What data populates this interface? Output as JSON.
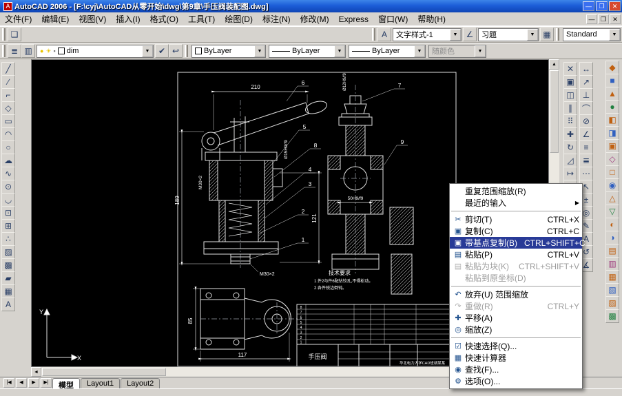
{
  "window": {
    "title": "AutoCAD 2006 - [F:\\cyj\\AutoCAD从零开始\\dwg\\第9章\\手压阀装配图.dwg]",
    "appicon_letter": "A",
    "controls": {
      "min": "—",
      "max": "❐",
      "close": "✕"
    }
  },
  "menus": [
    "文件(F)",
    "编辑(E)",
    "视图(V)",
    "插入(I)",
    "格式(O)",
    "工具(T)",
    "绘图(D)",
    "标注(N)",
    "修改(M)",
    "Express",
    "窗口(W)",
    "帮助(H)"
  ],
  "icons": {
    "combo_arrow": "▼",
    "new": "❑",
    "text_style": "A",
    "dim_style": "∠",
    "table_style": "▦",
    "layers": "≣",
    "layer_states": "▥",
    "make_layer_current": "✔",
    "layer_previous": "↩",
    "bulb": "●",
    "sun": "☀",
    "lock": "▪",
    "up": "▲",
    "down": "▼",
    "left": "◄",
    "right": "►"
  },
  "styles_toolbar": {
    "text_style_value": "文字样式-1",
    "dim_style_value": "习题",
    "table_style_value": "Standard"
  },
  "layers_toolbar": {
    "layer_value": "dim",
    "color_value": "ByLayer",
    "linetype_value": "ByLayer",
    "lineweight_value": "ByLayer",
    "plotstyle_value": "随颜色"
  },
  "colors": {
    "menu_highlight": "#283a97",
    "canvas_bg": "#000000",
    "titlebar_blue": "#1c5dd8",
    "close_red": "#d6492f"
  },
  "toolbars": {
    "draw": [
      {
        "name": "line-icon",
        "glyph": "╱"
      },
      {
        "name": "construction-line-icon",
        "glyph": "∕"
      },
      {
        "name": "polyline-icon",
        "glyph": "⌐"
      },
      {
        "name": "polygon-icon",
        "glyph": "◇"
      },
      {
        "name": "rectangle-icon",
        "glyph": "▭"
      },
      {
        "name": "arc-icon",
        "glyph": "◠"
      },
      {
        "name": "circle-icon",
        "glyph": "○"
      },
      {
        "name": "revision-cloud-icon",
        "glyph": "☁"
      },
      {
        "name": "spline-icon",
        "glyph": "∿"
      },
      {
        "name": "ellipse-icon",
        "glyph": "⊙"
      },
      {
        "name": "ellipse-arc-icon",
        "glyph": "◡"
      },
      {
        "name": "insert-block-icon",
        "glyph": "⊡"
      },
      {
        "name": "make-block-icon",
        "glyph": "⊞"
      },
      {
        "name": "point-icon",
        "glyph": "∴"
      },
      {
        "name": "hatch-icon",
        "glyph": "▨"
      },
      {
        "name": "gradient-icon",
        "glyph": "▩"
      },
      {
        "name": "region-icon",
        "glyph": "▰"
      },
      {
        "name": "table-icon",
        "glyph": "▦"
      },
      {
        "name": "multiline-text-icon",
        "glyph": "A"
      }
    ],
    "modify": [
      {
        "name": "erase-icon",
        "glyph": "✕"
      },
      {
        "name": "copy-object-icon",
        "glyph": "▣"
      },
      {
        "name": "mirror-icon",
        "glyph": "◫"
      },
      {
        "name": "offset-icon",
        "glyph": "∥"
      },
      {
        "name": "array-icon",
        "glyph": "⠿"
      },
      {
        "name": "move-icon",
        "glyph": "✚"
      },
      {
        "name": "rotate-icon",
        "glyph": "↻"
      },
      {
        "name": "scale-icon",
        "glyph": "◿"
      },
      {
        "name": "stretch-icon",
        "glyph": "↦"
      },
      {
        "name": "trim-icon",
        "glyph": "✂"
      },
      {
        "name": "extend-icon",
        "glyph": "→"
      },
      {
        "name": "break-at-point-icon",
        "glyph": "∣"
      },
      {
        "name": "break-icon",
        "glyph": "∦"
      },
      {
        "name": "chamfer-icon",
        "glyph": "◣"
      },
      {
        "name": "fillet-icon",
        "glyph": "⌒"
      },
      {
        "name": "explode-icon",
        "glyph": "✳"
      }
    ],
    "dimension": [
      {
        "name": "linear-dim-icon",
        "glyph": "↔"
      },
      {
        "name": "aligned-dim-icon",
        "glyph": "↗"
      },
      {
        "name": "ordinate-dim-icon",
        "glyph": "⊥"
      },
      {
        "name": "radius-dim-icon",
        "glyph": "⌒"
      },
      {
        "name": "diameter-dim-icon",
        "glyph": "⊘"
      },
      {
        "name": "angular-dim-icon",
        "glyph": "∠"
      },
      {
        "name": "quick-dim-icon",
        "glyph": "≡"
      },
      {
        "name": "baseline-dim-icon",
        "glyph": "≣"
      },
      {
        "name": "continue-dim-icon",
        "glyph": "⋯"
      },
      {
        "name": "leader-icon",
        "glyph": "↖"
      },
      {
        "name": "tolerance-icon",
        "glyph": "±"
      },
      {
        "name": "center-mark-icon",
        "glyph": "◎"
      },
      {
        "name": "dim-edit-icon",
        "glyph": "✎"
      },
      {
        "name": "dim-text-edit-icon",
        "glyph": "A"
      },
      {
        "name": "dim-update-icon",
        "glyph": "↺"
      },
      {
        "name": "dim-style-icon",
        "glyph": "∡"
      }
    ],
    "outer": [
      {
        "name": "dock-tool-icon",
        "glyph": "◆",
        "color": "#c06010"
      },
      {
        "name": "dock-tool-icon",
        "glyph": "■",
        "color": "#3060c0"
      },
      {
        "name": "dock-tool-icon",
        "glyph": "▲",
        "color": "#c06010"
      },
      {
        "name": "dock-tool-icon",
        "glyph": "●",
        "color": "#208040"
      },
      {
        "name": "dock-tool-icon",
        "glyph": "◧",
        "color": "#c06010"
      },
      {
        "name": "dock-tool-icon",
        "glyph": "◨",
        "color": "#3060c0"
      },
      {
        "name": "dock-tool-icon",
        "glyph": "▣",
        "color": "#c06010"
      },
      {
        "name": "dock-tool-icon",
        "glyph": "◇",
        "color": "#a04080"
      },
      {
        "name": "dock-tool-icon",
        "glyph": "□",
        "color": "#c06010"
      },
      {
        "name": "dock-tool-icon",
        "glyph": "◉",
        "color": "#3060c0"
      },
      {
        "name": "dock-tool-icon",
        "glyph": "△",
        "color": "#c06010"
      },
      {
        "name": "dock-tool-icon",
        "glyph": "▽",
        "color": "#208040"
      },
      {
        "name": "dock-tool-icon",
        "glyph": "◐",
        "color": "#c06010"
      },
      {
        "name": "dock-tool-icon",
        "glyph": "◑",
        "color": "#3060c0"
      },
      {
        "name": "dock-tool-icon",
        "glyph": "▤",
        "color": "#c06010"
      },
      {
        "name": "dock-tool-icon",
        "glyph": "▥",
        "color": "#a04080"
      },
      {
        "name": "dock-tool-icon",
        "glyph": "▦",
        "color": "#c06010"
      },
      {
        "name": "dock-tool-icon",
        "glyph": "▧",
        "color": "#3060c0"
      },
      {
        "name": "dock-tool-icon",
        "glyph": "▨",
        "color": "#c06010"
      },
      {
        "name": "dock-tool-icon",
        "glyph": "▩",
        "color": "#208040"
      }
    ]
  },
  "context_menu": {
    "items": [
      {
        "label": "重复范围缩放(R)",
        "icon": "",
        "shortcut": ""
      },
      {
        "label": "最近的输入",
        "icon": "",
        "shortcut": "",
        "arrow": "▶"
      },
      {
        "type": "sep"
      },
      {
        "label": "剪切(T)",
        "icon": "✂",
        "shortcut": "CTRL+X"
      },
      {
        "label": "复制(C)",
        "icon": "▣",
        "shortcut": "CTRL+C"
      },
      {
        "label": "带基点复制(B)",
        "icon": "▣",
        "shortcut": "CTRL+SHIFT+C",
        "highlighted": true
      },
      {
        "label": "粘贴(P)",
        "icon": "▤",
        "shortcut": "CTRL+V"
      },
      {
        "label": "粘贴为块(K)",
        "icon": "▤",
        "shortcut": "CTRL+SHIFT+V",
        "disabled": true
      },
      {
        "label": "粘贴到原坐标(D)",
        "icon": "",
        "shortcut": "",
        "disabled": true
      },
      {
        "type": "sep"
      },
      {
        "label": "放弃(U) 范围缩放",
        "icon": "↶",
        "shortcut": ""
      },
      {
        "label": "重做(R)",
        "icon": "↷",
        "shortcut": "CTRL+Y",
        "disabled": true
      },
      {
        "label": "平移(A)",
        "icon": "✚",
        "shortcut": ""
      },
      {
        "label": "缩放(Z)",
        "icon": "◎",
        "shortcut": ""
      },
      {
        "type": "sep"
      },
      {
        "label": "快速选择(Q)...",
        "icon": "☑",
        "shortcut": ""
      },
      {
        "label": "快速计算器",
        "icon": "▦",
        "shortcut": ""
      },
      {
        "label": "查找(F)...",
        "icon": "◉",
        "shortcut": ""
      },
      {
        "label": "选项(O)...",
        "icon": "⚙",
        "shortcut": ""
      }
    ]
  },
  "tabs": {
    "nav": [
      "|◀",
      "◀",
      "▶",
      "▶|"
    ],
    "items": [
      "模型",
      "Layout1",
      "Layout2"
    ],
    "active": "模型"
  },
  "drawing": {
    "dims": {
      "d210": "210",
      "d189": "189",
      "d121": "121",
      "d50": "50H9/f9",
      "d85": "85",
      "d117": "117",
      "dia15": "Ø15H9/f9",
      "dia12": "Ø12H9/f9",
      "m30_left": "M30×2",
      "m30_bottom": "M30×2"
    },
    "balloons": [
      "1",
      "2",
      "3",
      "4",
      "5",
      "6",
      "7",
      "8",
      "9"
    ],
    "tech": {
      "title": "技术要求",
      "line1": "1.件2与件6配钻铰孔,不得松动。",
      "line2": "2.各件锐边倒钝。"
    },
    "titleblock": {
      "title": "手压阀",
      "org": "华北电力大学CAD班胡某某"
    },
    "bom": [
      "8",
      "7",
      "6",
      "5",
      "4",
      "3",
      "2",
      "1"
    ],
    "ucs": {
      "x": "X",
      "y": "Y"
    }
  }
}
